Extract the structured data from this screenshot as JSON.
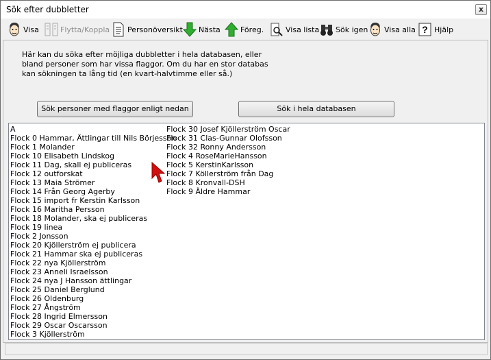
{
  "window": {
    "title": "Sök efter dubbletter",
    "close_label": "x"
  },
  "toolbar": {
    "items": [
      {
        "label": "Visa",
        "icon": "face-icon",
        "enabled": true
      },
      {
        "label": "Flytta/Koppla",
        "icon": "move-link-icon",
        "enabled": false
      },
      {
        "label": "Personöversikt",
        "icon": "document-icon",
        "enabled": true
      },
      {
        "label": "Nästa",
        "icon": "arrow-down-icon",
        "enabled": true
      },
      {
        "label": "Föreg.",
        "icon": "arrow-up-icon",
        "enabled": true
      },
      {
        "label": "Visa lista",
        "icon": "magnifier-list-icon",
        "enabled": true
      },
      {
        "label": "Sök igen",
        "icon": "binoculars-icon",
        "enabled": true
      },
      {
        "label": "Visa alla",
        "icon": "face-icon",
        "enabled": true
      },
      {
        "label": "Hjälp",
        "icon": "help-icon",
        "enabled": true
      }
    ]
  },
  "info_text": "Här kan du söka efter möjliga dubbletter i hela databasen, eller bland personer som har vissa flaggor. Om du har en stor databas kan sökningen ta lång tid (en kvart-halvtimme eller så.)",
  "buttons": {
    "search_flags": "Sök personer med flaggor enligt nedan",
    "search_all": "Sök i hela databasen"
  },
  "list": {
    "column1": [
      "A",
      "Flock 0 Hammar, Ättlingar till Nils Börjesson",
      "Flock 1 Molander",
      "Flock 10 Elisabeth Lindskog",
      "Flock 11 Dag, skall ej publiceras",
      "Flock 12 outforskat",
      "Flock 13 Maia Strömer",
      "Flock 14 Från Georg Agerby",
      "Flock 15 import fr Kerstin Karlsson",
      "Flock 16 Maritha Persson",
      "Flock 18 Molander, ska ej publiceras",
      "Flock 19 linea",
      "Flock 2 Jonsson",
      "Flock 20 Kjöllerström ej publicera",
      "Flock 21 Hammar ska ej publiceras",
      "Flock 22 nya Kjöllerström",
      "Flock 23 Anneli Israelsson",
      "Flock 24 nya J Hansson ättlingar",
      "Flock 25 Daniel Berglund",
      "Flock 26 Oldenburg",
      "Flock 27 Ångström",
      "Flock 28 Ingrid Elmersson",
      "Flock 29 Oscar Oscarsson",
      "Flock 3 Kjöllerström"
    ],
    "column2": [
      "Flock 30 Josef Kjöllerström Oscar",
      "Flock 31 Clas-Gunnar Olofsson",
      "Flock 32 Ronny Andersson",
      "Flock 4 RoseMarieHansson",
      "Flock 5 KerstinKarlsson",
      "Flock 7 Köllerström från Dag",
      "Flock 8 Kronvall-DSH",
      "Flock 9 Äldre Hammar"
    ]
  }
}
